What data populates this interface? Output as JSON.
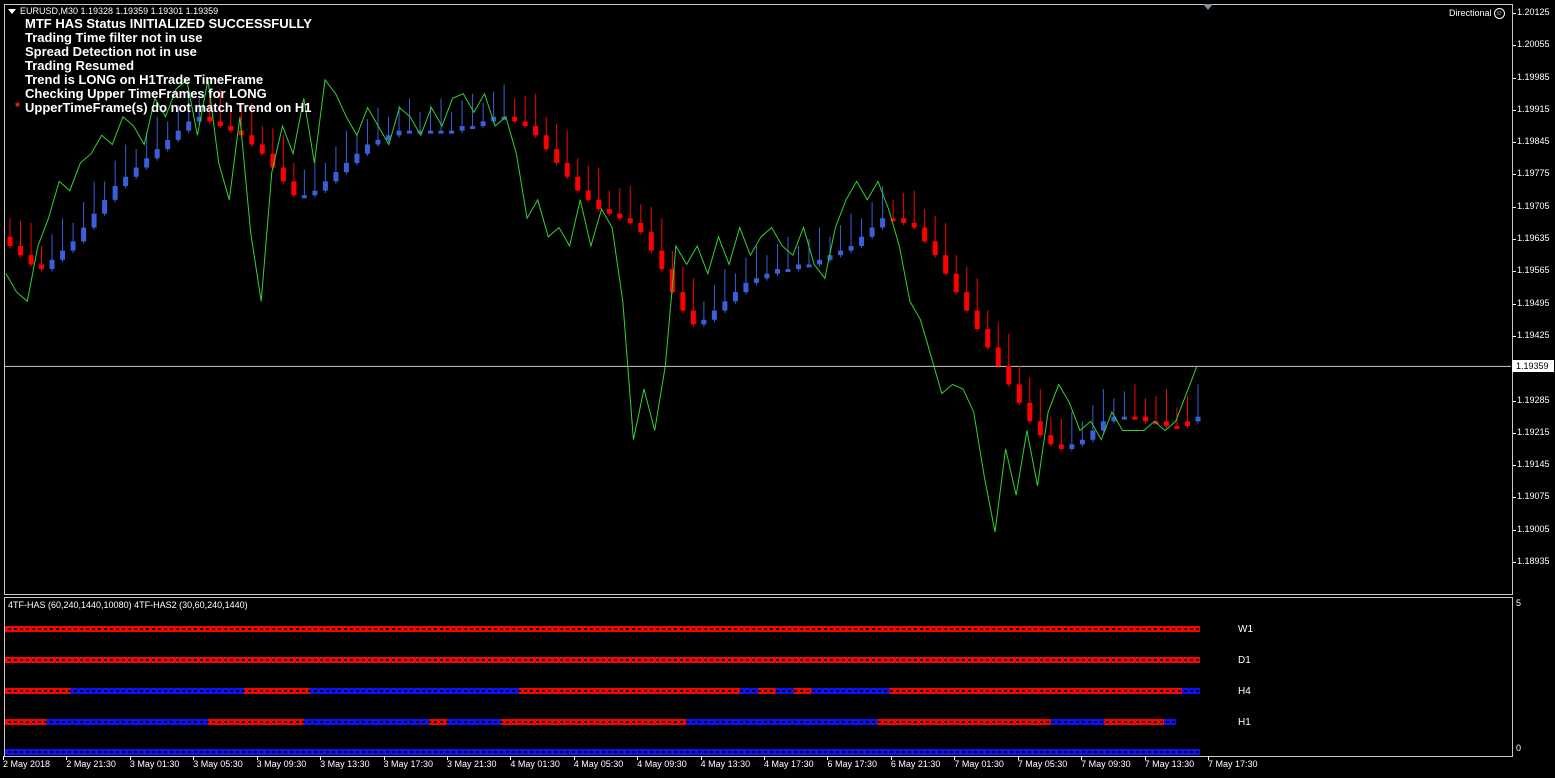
{
  "header": {
    "symbol_info": "EURUSD,M30  1.19328 1.19359 1.19301 1.19359",
    "directional_label": "Directional",
    "smiley_glyph": "☺"
  },
  "status": {
    "lines": [
      "MTF HAS Status INITIALIZED SUCCESSFULLY",
      "Trading Time filter not in use",
      "Spread Detection not in use",
      "Trading Resumed",
      "Trend is LONG on H1Trade TimeFrame",
      "Checking Upper TimeFrames for LONG",
      "UpperTimeFrame(s) do not match Trend on H1"
    ],
    "star": "*"
  },
  "price_axis": {
    "labels": [
      "1.20125",
      "1.20055",
      "1.19985",
      "1.19915",
      "1.19845",
      "1.19775",
      "1.19705",
      "1.19635",
      "1.19565",
      "1.19495",
      "1.19425",
      "1.19285",
      "1.19215",
      "1.19145",
      "1.19075",
      "1.19005",
      "1.18935"
    ],
    "current_price": "1.19359"
  },
  "time_axis": {
    "labels": [
      "2 May 2018",
      "2 May 21:30",
      "3 May 01:30",
      "3 May 05:30",
      "3 May 09:30",
      "3 May 13:30",
      "3 May 17:30",
      "3 May 21:30",
      "4 May 01:30",
      "4 May 05:30",
      "4 May 09:30",
      "4 May 13:30",
      "4 May 17:30",
      "6 May 17:30",
      "6 May 21:30",
      "7 May 01:30",
      "7 May 05:30",
      "7 May 09:30",
      "7 May 13:30",
      "7 May 17:30"
    ]
  },
  "indicator": {
    "title": "4TF-HAS (60,240,1440,10080)  4TF-HAS2 (30,60,240,1440)",
    "axis_max": "5",
    "axis_min": "0",
    "rows": [
      {
        "label": "W1",
        "segments": [
          {
            "color": "red",
            "length": 100
          }
        ]
      },
      {
        "label": "D1",
        "segments": [
          {
            "color": "red",
            "length": 100
          }
        ]
      },
      {
        "label": "H4",
        "segments": [
          {
            "color": "red",
            "length": 5.5
          },
          {
            "color": "blue",
            "length": 14.5
          },
          {
            "color": "red",
            "length": 5.5
          },
          {
            "color": "blue",
            "length": 17.5
          },
          {
            "color": "red",
            "length": 18.5
          },
          {
            "color": "blue",
            "length": 1.5
          },
          {
            "color": "red",
            "length": 1.5
          },
          {
            "color": "blue",
            "length": 1.5
          },
          {
            "color": "red",
            "length": 1.5
          },
          {
            "color": "blue",
            "length": 6.5
          },
          {
            "color": "red",
            "length": 24.5
          },
          {
            "color": "blue",
            "length": 1.5
          }
        ]
      },
      {
        "label": "H1",
        "segments": [
          {
            "color": "red",
            "length": 3.5
          },
          {
            "color": "blue",
            "length": 13.5
          },
          {
            "color": "red",
            "length": 8
          },
          {
            "color": "blue",
            "length": 10.5
          },
          {
            "color": "red",
            "length": 1.5
          },
          {
            "color": "blue",
            "length": 4.5
          },
          {
            "color": "red",
            "length": 15.5
          },
          {
            "color": "blue",
            "length": 16
          },
          {
            "color": "red",
            "length": 14.5
          },
          {
            "color": "blue",
            "length": 4.5
          },
          {
            "color": "red",
            "length": 5
          },
          {
            "color": "blue",
            "length": 1
          }
        ]
      },
      {
        "label": "",
        "segments": [
          {
            "color": "blue",
            "length": 100
          }
        ]
      }
    ]
  },
  "colors": {
    "bull_candle": "#3a5fd8",
    "bear_candle": "#ff0000",
    "indicator_line": "#32d232",
    "red_block": "#ff0000",
    "blue_block": "#1010ff",
    "grid_line": "#c8c8c8"
  },
  "series": {
    "ha_closes": [
      1.1962,
      1.196,
      1.1958,
      1.1957,
      1.1959,
      1.1961,
      1.1963,
      1.1966,
      1.1969,
      1.1972,
      1.1975,
      1.1977,
      1.1979,
      1.1981,
      1.1983,
      1.1985,
      1.1987,
      1.1989,
      1.199,
      1.1989,
      1.1988,
      1.1987,
      1.1986,
      1.1984,
      1.1982,
      1.1979,
      1.1976,
      1.1973,
      1.1973,
      1.1974,
      1.1976,
      1.1978,
      1.198,
      1.1982,
      1.1984,
      1.1985,
      1.1986,
      1.1987,
      1.1987,
      1.1987,
      1.1987,
      1.1987,
      1.1987,
      1.1988,
      1.1988,
      1.1989,
      1.199,
      1.199,
      1.1989,
      1.1988,
      1.1986,
      1.1983,
      1.198,
      1.1977,
      1.1974,
      1.1972,
      1.197,
      1.1969,
      1.1968,
      1.1967,
      1.1965,
      1.1961,
      1.1957,
      1.1952,
      1.1948,
      1.1945,
      1.1946,
      1.1948,
      1.195,
      1.1952,
      1.1954,
      1.1955,
      1.1956,
      1.1957,
      1.1957,
      1.1958,
      1.1958,
      1.1959,
      1.196,
      1.1961,
      1.1962,
      1.1964,
      1.1966,
      1.1968,
      1.1968,
      1.1967,
      1.1966,
      1.1963,
      1.196,
      1.1956,
      1.1952,
      1.1948,
      1.1944,
      1.194,
      1.1936,
      1.1932,
      1.1928,
      1.1924,
      1.1921,
      1.1919,
      1.1918,
      1.1919,
      1.192,
      1.1922,
      1.1924,
      1.1925,
      1.1925,
      1.1925,
      1.1924,
      1.1924,
      1.1923,
      1.1923,
      1.1924,
      1.1925
    ],
    "ha_trend": [
      "r",
      "r",
      "r",
      "r",
      "b",
      "b",
      "b",
      "b",
      "b",
      "b",
      "b",
      "b",
      "b",
      "b",
      "b",
      "b",
      "b",
      "b",
      "b",
      "r",
      "r",
      "r",
      "r",
      "r",
      "r",
      "r",
      "r",
      "r",
      "b",
      "b",
      "b",
      "b",
      "b",
      "b",
      "b",
      "b",
      "b",
      "b",
      "b",
      "b",
      "b",
      "b",
      "b",
      "b",
      "b",
      "b",
      "b",
      "b",
      "r",
      "r",
      "r",
      "r",
      "r",
      "r",
      "r",
      "r",
      "r",
      "r",
      "r",
      "r",
      "r",
      "r",
      "r",
      "r",
      "r",
      "r",
      "b",
      "b",
      "b",
      "b",
      "b",
      "b",
      "b",
      "b",
      "b",
      "b",
      "b",
      "b",
      "b",
      "b",
      "b",
      "b",
      "b",
      "b",
      "r",
      "r",
      "r",
      "r",
      "r",
      "r",
      "r",
      "r",
      "r",
      "r",
      "r",
      "r",
      "r",
      "r",
      "r",
      "r",
      "r",
      "b",
      "b",
      "b",
      "b",
      "b",
      "b",
      "r",
      "r",
      "r",
      "r",
      "r",
      "r",
      "b",
      "b"
    ],
    "line_values": [
      1.1956,
      1.1952,
      1.195,
      1.1962,
      1.1968,
      1.1976,
      1.1974,
      1.198,
      1.1982,
      1.1986,
      1.1984,
      1.199,
      1.1988,
      1.1984,
      1.1994,
      1.199,
      1.1996,
      1.1998,
      1.1986,
      1.1998,
      1.198,
      1.1972,
      1.199,
      1.1965,
      1.195,
      1.1978,
      1.1988,
      1.1982,
      1.1994,
      1.198,
      1.1998,
      1.1995,
      1.199,
      1.1986,
      1.1992,
      1.1988,
      1.1984,
      1.1992,
      1.199,
      1.1986,
      1.1992,
      1.1988,
      1.1994,
      1.1995,
      1.1991,
      1.1995,
      1.1988,
      1.199,
      1.1982,
      1.1968,
      1.1972,
      1.1964,
      1.1966,
      1.1962,
      1.1972,
      1.1962,
      1.197,
      1.1966,
      1.195,
      1.192,
      1.1931,
      1.1922,
      1.1936,
      1.1962,
      1.1958,
      1.1962,
      1.1956,
      1.1964,
      1.1958,
      1.1966,
      1.196,
      1.1964,
      1.1966,
      1.1962,
      1.196,
      1.1966,
      1.1958,
      1.1955,
      1.1966,
      1.1972,
      1.1976,
      1.1972,
      1.1976,
      1.197,
      1.1962,
      1.195,
      1.1946,
      1.1938,
      1.193,
      1.1932,
      1.1931,
      1.1926,
      1.1912,
      1.19,
      1.1918,
      1.1908,
      1.1922,
      1.191,
      1.1926,
      1.1932,
      1.1928,
      1.1922,
      1.1924,
      1.192,
      1.1926,
      1.1922,
      1.1922,
      1.1922,
      1.1924,
      1.1922,
      1.1924,
      1.193,
      1.1936
    ]
  }
}
